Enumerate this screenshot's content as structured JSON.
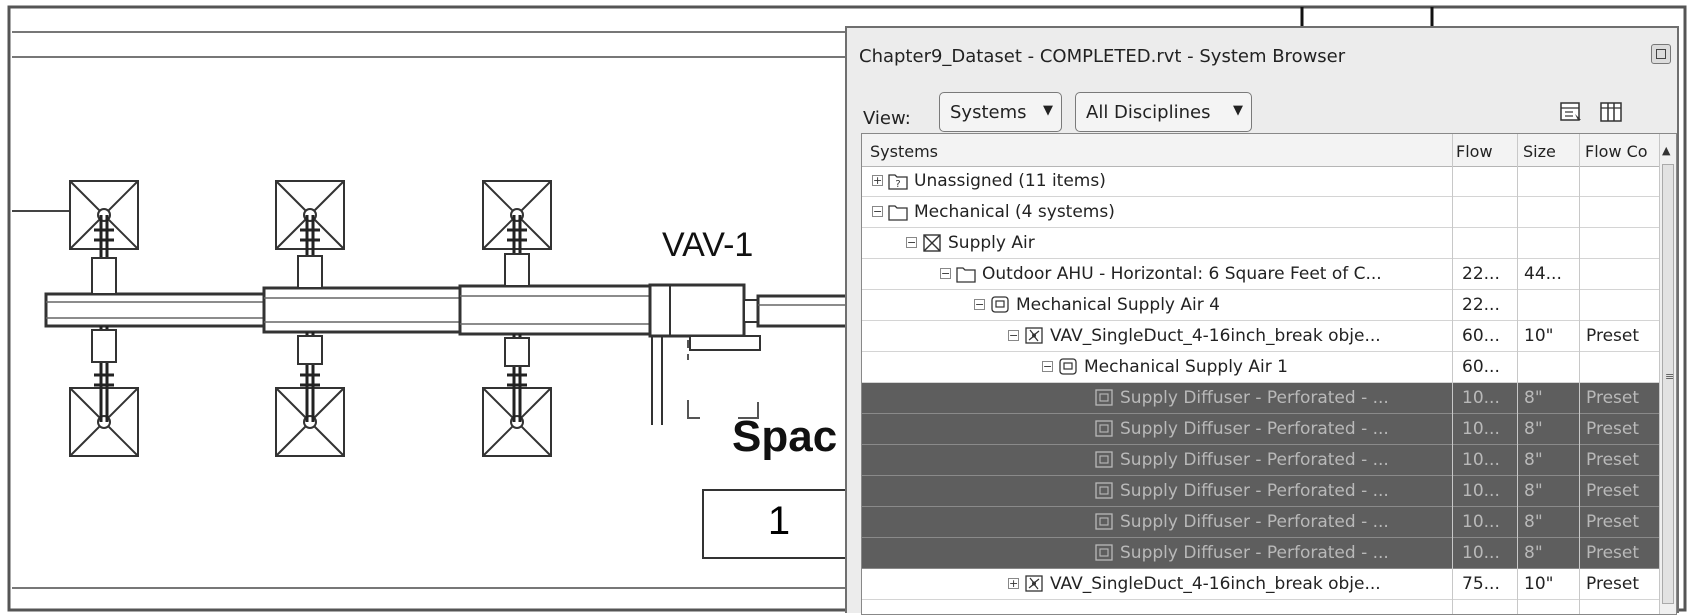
{
  "drawing": {
    "vav_tag": "VAV-1",
    "space_tag": "Spac",
    "room_number": "1"
  },
  "browser": {
    "title": "Chapter9_Dataset - COMPLETED.rvt - System Browser",
    "view_label": "View:",
    "view_dropdown": "Systems",
    "discipline_dropdown": "All Disciplines",
    "columns": {
      "systems": "Systems",
      "flow": "Flow",
      "size": "Size",
      "flow_config": "Flow Co"
    },
    "rows": [
      {
        "name": "Unassigned (11 items)",
        "flow": "",
        "size": "",
        "fc": ""
      },
      {
        "name": "Mechanical (4 systems)",
        "flow": "",
        "size": "",
        "fc": ""
      },
      {
        "name": "Supply Air",
        "flow": "",
        "size": "",
        "fc": ""
      },
      {
        "name": "Outdoor AHU - Horizontal: 6 Square Feet of C...",
        "flow": "22...",
        "size": "44...",
        "fc": ""
      },
      {
        "name": "Mechanical Supply Air 4",
        "flow": "22...",
        "size": "",
        "fc": ""
      },
      {
        "name": "VAV_SingleDuct_4-16inch_break obje...",
        "flow": "60...",
        "size": "10\"",
        "fc": "Preset"
      },
      {
        "name": "Mechanical Supply Air 1",
        "flow": "60...",
        "size": "",
        "fc": ""
      },
      {
        "name": "Supply Diffuser - Perforated - ...",
        "flow": "10...",
        "size": "8\"",
        "fc": "Preset"
      },
      {
        "name": "Supply Diffuser - Perforated - ...",
        "flow": "10...",
        "size": "8\"",
        "fc": "Preset"
      },
      {
        "name": "Supply Diffuser - Perforated - ...",
        "flow": "10...",
        "size": "8\"",
        "fc": "Preset"
      },
      {
        "name": "Supply Diffuser - Perforated - ...",
        "flow": "10...",
        "size": "8\"",
        "fc": "Preset"
      },
      {
        "name": "Supply Diffuser - Perforated - ...",
        "flow": "10...",
        "size": "8\"",
        "fc": "Preset"
      },
      {
        "name": "Supply Diffuser - Perforated - ...",
        "flow": "10...",
        "size": "8\"",
        "fc": "Preset"
      },
      {
        "name": "VAV_SingleDuct_4-16inch_break obje...",
        "flow": "75...",
        "size": "10\"",
        "fc": "Preset"
      }
    ],
    "icons": [
      "expand-collapse-icon",
      "unassigned-folder-icon",
      "folder-icon",
      "supply-air-icon",
      "equipment-icon",
      "duct-system-icon",
      "vav-fan-icon",
      "diffuser-icon",
      "layout-icon",
      "columns-icon",
      "restore-icon"
    ],
    "colors": {
      "selected_row": "#5e5e5e",
      "selected_text": "#b9b9b9"
    }
  }
}
